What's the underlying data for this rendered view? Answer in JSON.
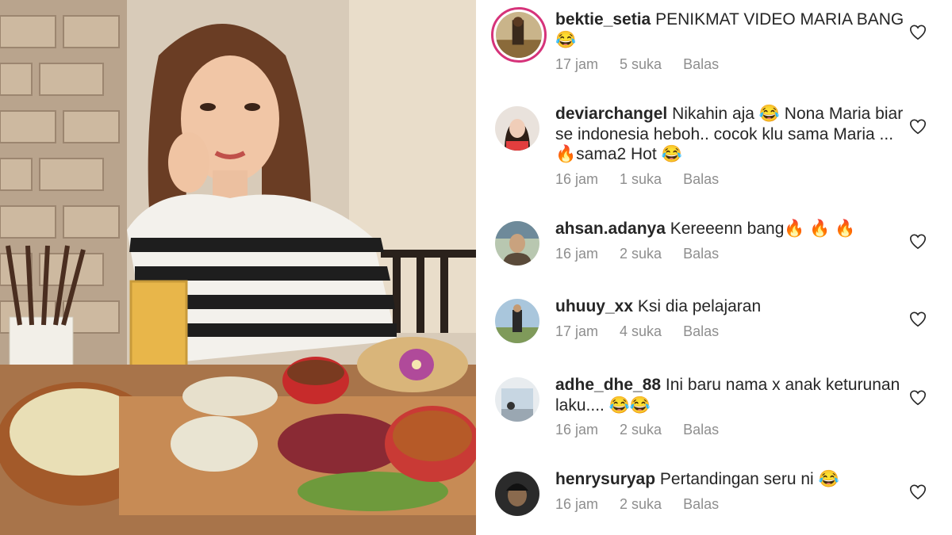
{
  "comments": [
    {
      "username": "bektie_setia",
      "text": "PENIKMAT VIDEO MARIA BANG 😂",
      "time": "17 jam",
      "likes": "5 suka",
      "reply": "Balas"
    },
    {
      "username": "deviarchangel",
      "text": "Nikahin aja 😂 Nona Maria biar se indonesia heboh.. cocok klu sama Maria ...🔥sama2 Hot 😂",
      "time": "16 jam",
      "likes": "1 suka",
      "reply": "Balas"
    },
    {
      "username": "ahsan.adanya",
      "text": "Kereeenn bang🔥 🔥 🔥",
      "time": "16 jam",
      "likes": "2 suka",
      "reply": "Balas"
    },
    {
      "username": "uhuuy_xx",
      "text": "Ksi dia pelajaran",
      "time": "17 jam",
      "likes": "4 suka",
      "reply": "Balas"
    },
    {
      "username": "adhe_dhe_88",
      "text": "Ini  baru nama x anak keturunan laku.... 😂😂",
      "time": "16 jam",
      "likes": "2 suka",
      "reply": "Balas"
    },
    {
      "username": "henrysuryap",
      "text": "Pertandingan seru ni 😂",
      "time": "16 jam",
      "likes": "2 suka",
      "reply": "Balas"
    }
  ],
  "icons": {
    "like": "heart-outline-icon"
  },
  "colors": {
    "text": "#262626",
    "meta": "#8e8e8e",
    "story_ring": "#d6337a"
  }
}
